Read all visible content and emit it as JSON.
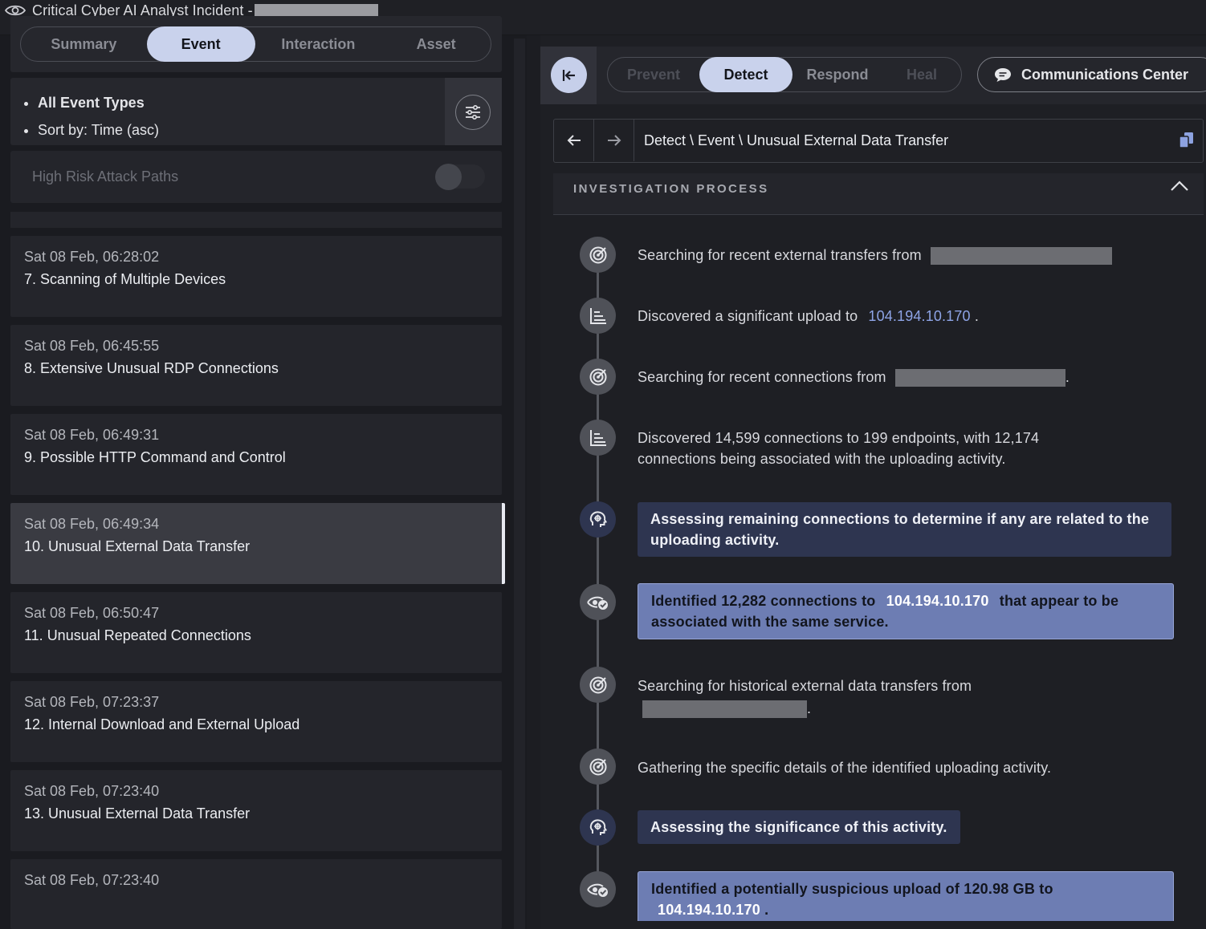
{
  "window": {
    "title": "Critical Cyber AI Analyst Incident -"
  },
  "left_tabs": [
    "Summary",
    "Event",
    "Interaction",
    "Asset"
  ],
  "filter": {
    "items": [
      "All Event Types",
      "Sort by: Time (asc)"
    ]
  },
  "risk": {
    "label": "High Risk Attack Paths",
    "enabled": false
  },
  "events": [
    {
      "time": "Sat 08 Feb, 06:28:02",
      "name": "7. Scanning of Multiple Devices"
    },
    {
      "time": "Sat 08 Feb, 06:45:55",
      "name": "8. Extensive Unusual RDP Connections"
    },
    {
      "time": "Sat 08 Feb, 06:49:31",
      "name": "9. Possible HTTP Command and Control"
    },
    {
      "time": "Sat 08 Feb, 06:49:34",
      "name": "10. Unusual External Data Transfer",
      "selected": true
    },
    {
      "time": "Sat 08 Feb, 06:50:47",
      "name": "11. Unusual Repeated Connections"
    },
    {
      "time": "Sat 08 Feb, 07:23:37",
      "name": "12. Internal Download and External Upload"
    },
    {
      "time": "Sat 08 Feb, 07:23:40",
      "name": "13. Unusual External Data Transfer"
    },
    {
      "time": "Sat 08 Feb, 07:23:40",
      "name": ""
    }
  ],
  "phase_tabs": [
    "Prevent",
    "Detect",
    "Respond",
    "Heal"
  ],
  "comm_center": "Communications Center",
  "breadcrumb": "Detect \\ Event \\ Unusual External Data Transfer",
  "investigation": {
    "header": "INVESTIGATION PROCESS",
    "steps": [
      {
        "icon": "target-icon",
        "text": "Searching for recent external transfers from"
      },
      {
        "icon": "chart-icon",
        "text": "Discovered a significant upload to",
        "ip": "104.194.10.170",
        "suffix": "."
      },
      {
        "icon": "target-icon",
        "text": "Searching for recent connections from",
        "suffix": "."
      },
      {
        "icon": "chart-icon",
        "line1": "Discovered 14,599 connections to 199 endpoints, with 12,174",
        "line2": "connections being associated with the uploading activity."
      },
      {
        "icon": "brain-icon",
        "line1": "Assessing remaining connections to determine if any are related to the",
        "line2": "uploading activity."
      },
      {
        "icon": "eye-check-icon",
        "pre": "Identified 12,282 connections to",
        "ip": "104.194.10.170",
        "post": "that appear to be",
        "line2": "associated with the same service."
      },
      {
        "icon": "target-icon",
        "text": "Searching for historical external data transfers from",
        "suffix": "."
      },
      {
        "icon": "target-icon",
        "text": "Gathering the specific details of the identified uploading activity."
      },
      {
        "icon": "brain-icon",
        "text": "Assessing the significance of this activity."
      },
      {
        "icon": "eye-check-icon",
        "text": "Identified a potentially suspicious upload of 120.98 GB to",
        "ip": "104.194.10.170",
        "suffix": "."
      }
    ]
  }
}
